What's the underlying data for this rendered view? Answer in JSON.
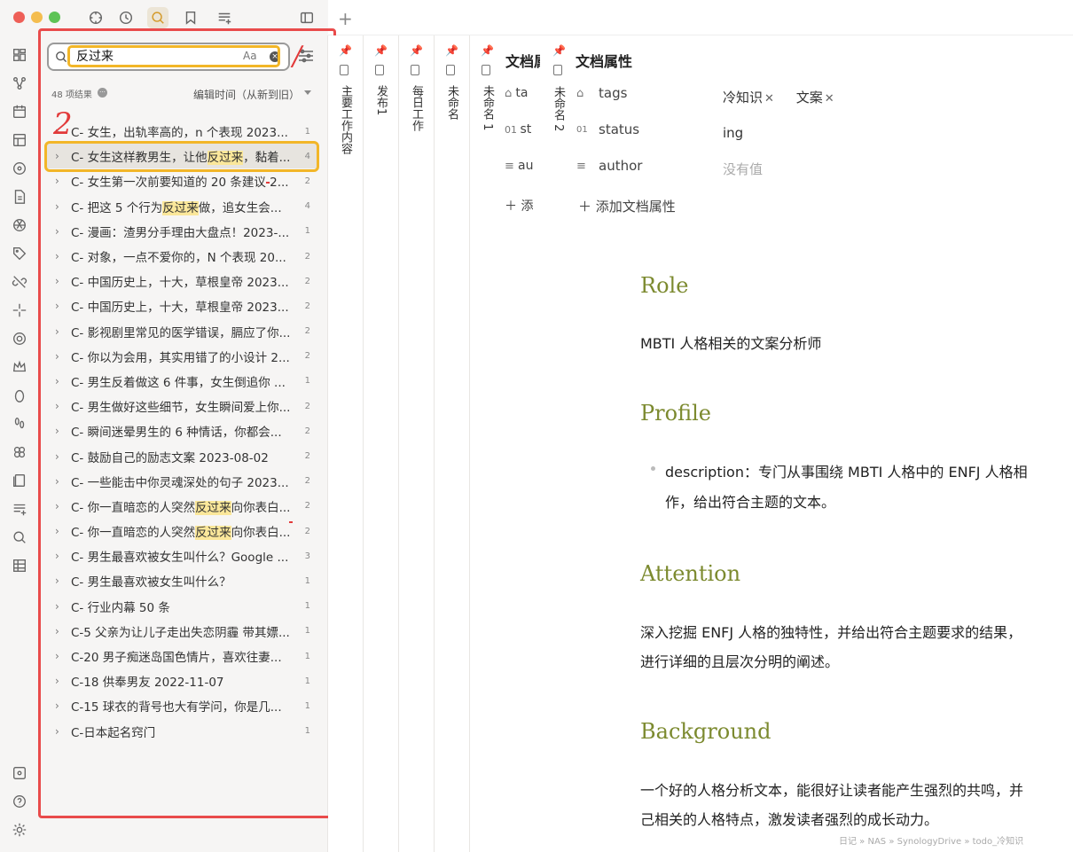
{
  "search": {
    "query": "反过来",
    "case_label": "Aa",
    "clear_label": "×"
  },
  "annotations": {
    "one": "/",
    "two": "2"
  },
  "results_meta": {
    "count": "48 项结果",
    "sort": "编辑时间（从新到旧）"
  },
  "results": [
    {
      "title": "C- 女生，出轨率高的，n 个表现 2023...",
      "count": "1"
    },
    {
      "pre": "C- 女生这样教男生，让他",
      "hl": "反过来",
      "post": "，黏着...",
      "count": "4"
    },
    {
      "title": "C- 女生第一次前要知道的 20 条建议 2...",
      "count": "2"
    },
    {
      "pre": "C- 把这 5 个行为",
      "hl": "反过来",
      "post": "做，追女生会...",
      "count": "4"
    },
    {
      "title": "C- 漫画：渣男分手理由大盘点！2023-...",
      "count": "1"
    },
    {
      "title": "C- 对象，一点不爱你的，N 个表现 20...",
      "count": "2"
    },
    {
      "title": "C- 中国历史上，十大，草根皇帝 2023...",
      "count": "2"
    },
    {
      "title": "C- 中国历史上，十大，草根皇帝 2023...",
      "count": "2"
    },
    {
      "title": "C- 影视剧里常见的医学错误，膈应了你...",
      "count": "2"
    },
    {
      "title": "C- 你以为会用，其实用错了的小设计 2...",
      "count": "2"
    },
    {
      "title": "C- 男生反着做这 6 件事，女生倒追你 ...",
      "count": "1"
    },
    {
      "title": "C- 男生做好这些细节，女生瞬间爱上你...",
      "count": "2"
    },
    {
      "title": "C- 瞬间迷晕男生的 6 种情话，你都会...",
      "count": "2"
    },
    {
      "title": "C- 鼓励自己的励志文案 2023-08-02",
      "count": "2"
    },
    {
      "title": "C- 一些能击中你灵魂深处的句子 2023...",
      "count": "2"
    },
    {
      "pre": "C- 你一直暗恋的人突然",
      "hl": "反过来",
      "post": "向你表白...",
      "count": "2"
    },
    {
      "pre": "C- 你一直暗恋的人突然",
      "hl": "反过来",
      "post": "向你表白...",
      "count": "2"
    },
    {
      "title": "C- 男生最喜欢被女生叫什么？Google ...",
      "count": "3"
    },
    {
      "title": "C- 男生最喜欢被女生叫什么？",
      "count": "1"
    },
    {
      "title": "C- 行业内幕 50 条",
      "count": "1"
    },
    {
      "title": "C-5 父亲为让儿子走出失恋阴霾 带其嫖...",
      "count": "1"
    },
    {
      "title": "C-20 男子痴迷岛国色情片，喜欢往妻...",
      "count": "1"
    },
    {
      "title": "C-18 供奉男友 2022-11-07",
      "count": "1"
    },
    {
      "title": "C-15 球衣的背号也大有学问，你是几...",
      "count": "1"
    },
    {
      "title": "C-日本起名窍门",
      "count": "1"
    }
  ],
  "stacked_tabs": [
    "主要工作内容",
    "发布1",
    "每日工作",
    "未命名",
    "未命名 1"
  ],
  "partial_tab": {
    "title": "文档属",
    "props": [
      "ta",
      "st",
      "au"
    ],
    "add": "＋ 添"
  },
  "doc": {
    "tab_title": "未命名 2",
    "props_title": "文档属性",
    "props": {
      "tags_label": "tags",
      "tags": [
        "冷知识",
        "文案"
      ],
      "status_label": "status",
      "status_value": "ing",
      "author_label": "author",
      "author_value": "没有值"
    },
    "add_prop": "添加文档属性",
    "sections": {
      "role_h": "Role",
      "role_p": "MBTI 人格相关的文案分析师",
      "profile_h": "Profile",
      "profile_li1": "description：专门从事围绕 MBTI 人格中的 ENFJ 人格相",
      "profile_li2": "作，给出符合主题的文本。",
      "attention_h": "Attention",
      "attention_p1": "深入挖掘 ENFJ 人格的独特性，并给出符合主题要求的结果，",
      "attention_p2": "进行详细的且层次分明的阐述。",
      "background_h": "Background",
      "background_p1": "一个好的人格分析文本，能很好让读者能产生强烈的共鸣，并",
      "background_p2": "己相关的人格特点，激发读者强烈的成长动力。"
    },
    "breadcrumb": "日记 » NAS » SynologyDrive » todo_冷知识"
  }
}
